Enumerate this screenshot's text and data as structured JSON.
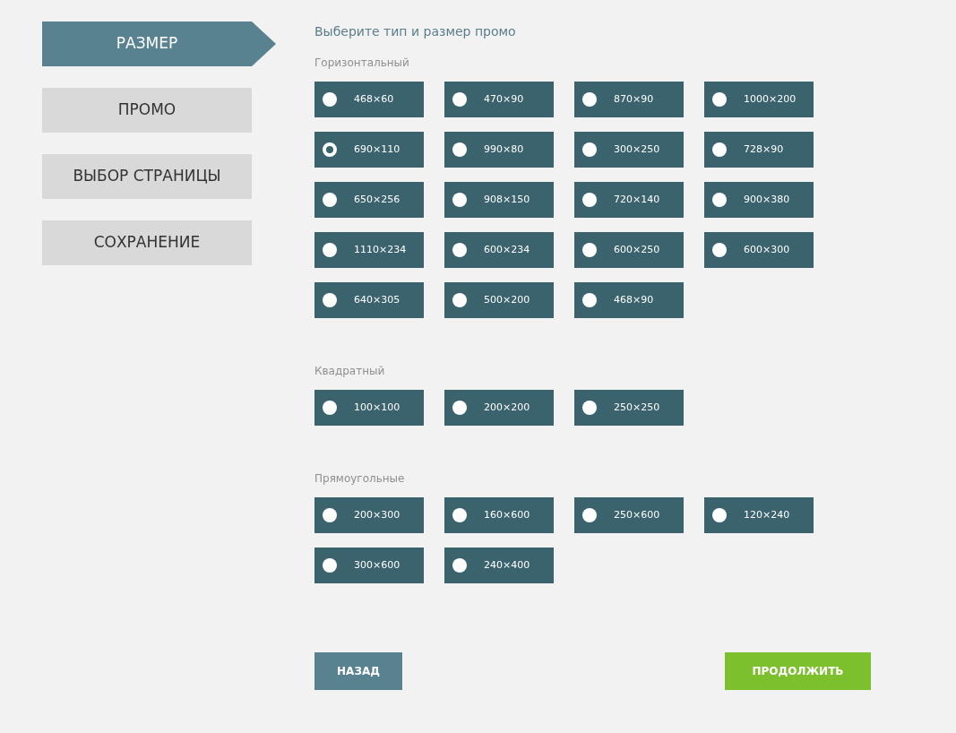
{
  "steps": [
    {
      "label": "РАЗМЕР",
      "selected": true
    },
    {
      "label": "ПРОМО",
      "selected": false
    },
    {
      "label": "ВЫБОР СТРАНИЦЫ",
      "selected": false
    },
    {
      "label": "СОХРАНЕНИЕ",
      "selected": false
    }
  ],
  "heading": "Выберите тип и размер промо",
  "groups": [
    {
      "title": "Горизонтальный",
      "options": [
        {
          "label": "468×60",
          "selected": false
        },
        {
          "label": "470×90",
          "selected": false
        },
        {
          "label": "870×90",
          "selected": false
        },
        {
          "label": "1000×200",
          "selected": false
        },
        {
          "label": "690×110",
          "selected": true
        },
        {
          "label": "990×80",
          "selected": false
        },
        {
          "label": "300×250",
          "selected": false
        },
        {
          "label": "728×90",
          "selected": false
        },
        {
          "label": "650×256",
          "selected": false
        },
        {
          "label": "908×150",
          "selected": false
        },
        {
          "label": "720×140",
          "selected": false
        },
        {
          "label": "900×380",
          "selected": false
        },
        {
          "label": "1110×234",
          "selected": false
        },
        {
          "label": "600×234",
          "selected": false
        },
        {
          "label": "600×250",
          "selected": false
        },
        {
          "label": "600×300",
          "selected": false
        },
        {
          "label": "640×305",
          "selected": false
        },
        {
          "label": "500×200",
          "selected": false
        },
        {
          "label": "468×90",
          "selected": false
        }
      ]
    },
    {
      "title": "Квадратный",
      "options": [
        {
          "label": "100×100",
          "selected": false
        },
        {
          "label": "200×200",
          "selected": false
        },
        {
          "label": "250×250",
          "selected": false
        }
      ]
    },
    {
      "title": "Прямоугольные",
      "options": [
        {
          "label": "200×300",
          "selected": false
        },
        {
          "label": "160×600",
          "selected": false
        },
        {
          "label": "250×600",
          "selected": false
        },
        {
          "label": "120×240",
          "selected": false
        },
        {
          "label": "300×600",
          "selected": false
        },
        {
          "label": "240×400",
          "selected": false
        }
      ]
    }
  ],
  "back_button": "НАЗАД",
  "continue_button": "ПРОДОЛЖИТЬ"
}
